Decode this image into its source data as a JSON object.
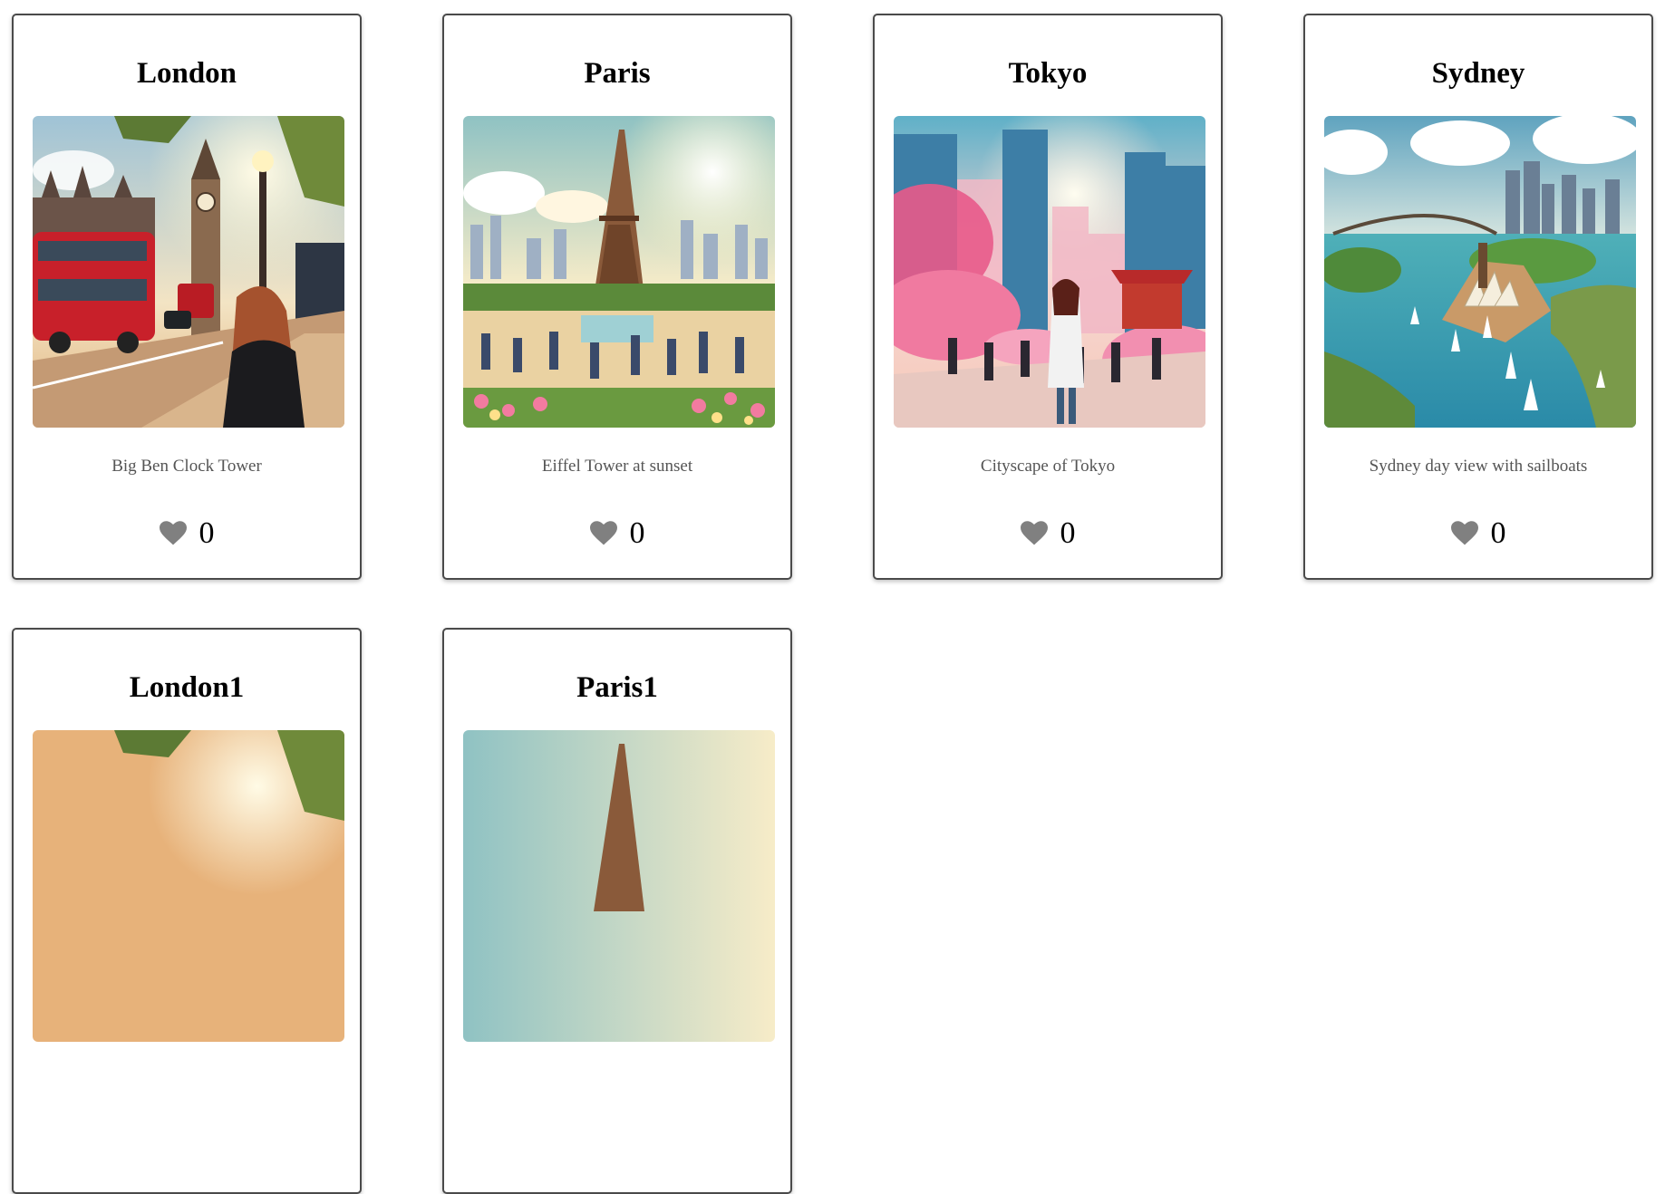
{
  "cards": [
    {
      "title": "London",
      "caption": "Big Ben Clock Tower",
      "likes": "0",
      "theme": "london"
    },
    {
      "title": "Paris",
      "caption": "Eiffel Tower at sunset",
      "likes": "0",
      "theme": "paris"
    },
    {
      "title": "Tokyo",
      "caption": "Cityscape of Tokyo",
      "likes": "0",
      "theme": "tokyo"
    },
    {
      "title": "Sydney",
      "caption": "Sydney day view with sailboats",
      "likes": "0",
      "theme": "sydney"
    },
    {
      "title": "London1",
      "theme": "london"
    },
    {
      "title": "Paris1",
      "theme": "paris"
    }
  ],
  "heart_color": "#808080"
}
